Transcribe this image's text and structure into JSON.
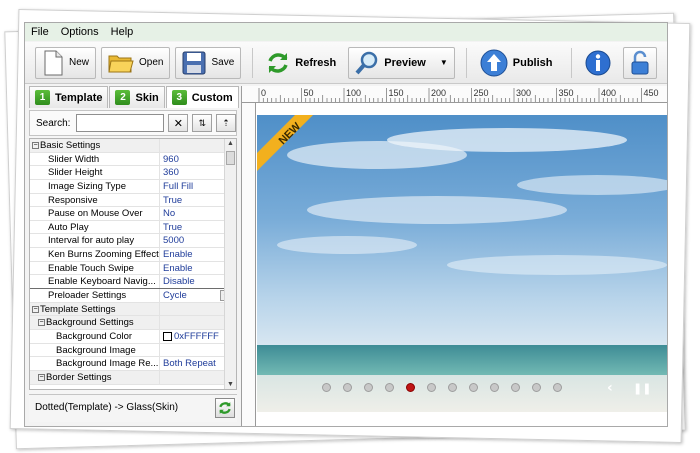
{
  "menu": {
    "file": "File",
    "options": "Options",
    "help": "Help"
  },
  "toolbar": {
    "new": "New",
    "open": "Open",
    "save": "Save",
    "refresh": "Refresh",
    "preview": "Preview",
    "publish": "Publish"
  },
  "tabs": [
    {
      "num": "1",
      "label": "Template"
    },
    {
      "num": "2",
      "label": "Skin"
    },
    {
      "num": "3",
      "label": "Custom"
    }
  ],
  "search": {
    "label": "Search:",
    "value": ""
  },
  "properties": [
    {
      "name": "Basic Settings",
      "value": "",
      "kind": "cat"
    },
    {
      "name": "Slider Width",
      "value": "960",
      "kind": "item"
    },
    {
      "name": "Slider Height",
      "value": "360",
      "kind": "item"
    },
    {
      "name": "Image Sizing Type",
      "value": "Full Fill",
      "kind": "item"
    },
    {
      "name": "Responsive",
      "value": "True",
      "kind": "item"
    },
    {
      "name": "Pause on Mouse Over",
      "value": "No",
      "kind": "item"
    },
    {
      "name": "Auto Play",
      "value": "True",
      "kind": "item"
    },
    {
      "name": "Interval for auto play",
      "value": "5000",
      "kind": "item"
    },
    {
      "name": "Ken Burns Zooming Effect",
      "value": "Enable",
      "kind": "item"
    },
    {
      "name": "Enable Touch Swipe",
      "value": "Enable",
      "kind": "item"
    },
    {
      "name": "Enable Keyboard Navig...",
      "value": "Disable",
      "kind": "item"
    },
    {
      "name": "Preloader Settings",
      "value": "Cycle",
      "kind": "sel"
    },
    {
      "name": "Template Settings",
      "value": "",
      "kind": "cat"
    },
    {
      "name": "Background Settings",
      "value": "",
      "kind": "sub"
    },
    {
      "name": "Background Color",
      "value": "0xFFFFFF",
      "kind": "color"
    },
    {
      "name": "Background Image",
      "value": "",
      "kind": "sub2"
    },
    {
      "name": "Background Image Re...",
      "value": "Both Repeat",
      "kind": "sub2"
    },
    {
      "name": "Border Settings",
      "value": "",
      "kind": "sub"
    }
  ],
  "status": {
    "text": "Dotted(Template) -> Glass(Skin)"
  },
  "ruler": {
    "ticks": [
      "0",
      "50",
      "100",
      "150",
      "200",
      "250",
      "300",
      "350",
      "400",
      "450"
    ]
  },
  "slider": {
    "badge": "NEW",
    "dots": 12,
    "active_dot": 5
  },
  "colors": {
    "accent_green": "#3aa22a",
    "dot_active": "#c01515",
    "value_blue": "#1f3c9a"
  }
}
